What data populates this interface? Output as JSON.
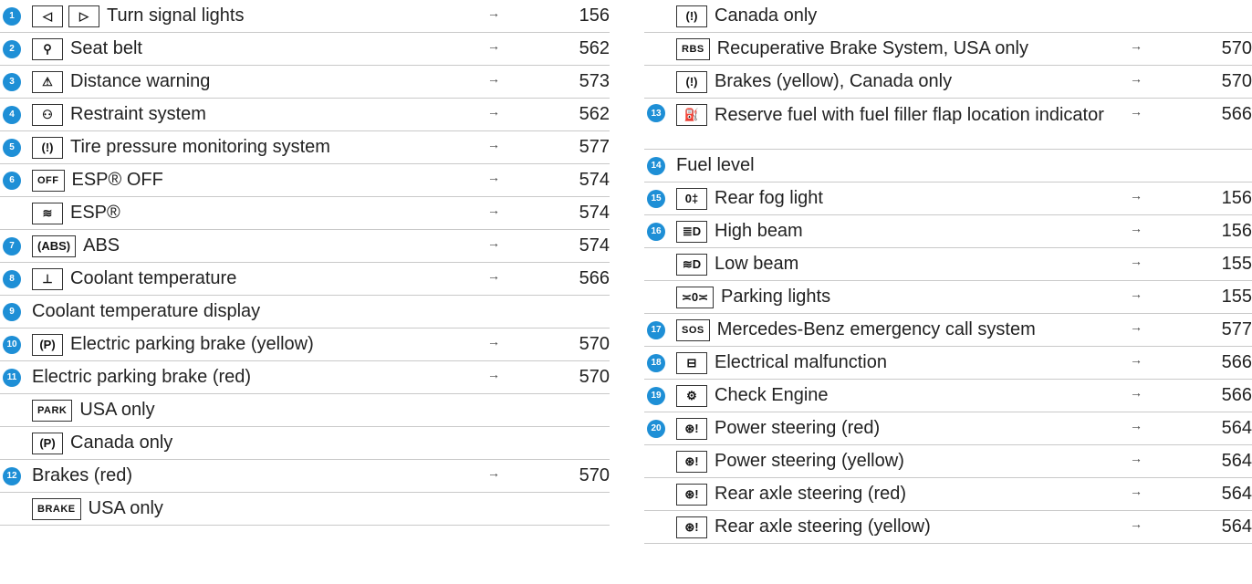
{
  "left": [
    {
      "num": "1",
      "icons": [
        "◁",
        "▷"
      ],
      "label": "Turn signal lights",
      "page": "156",
      "icon_names": [
        "turn-left-icon",
        "turn-right-icon"
      ]
    },
    {
      "num": "2",
      "icons": [
        "⚲"
      ],
      "label": "Seat belt",
      "page": "562",
      "icon_names": [
        "seat-belt-icon"
      ]
    },
    {
      "num": "3",
      "icons": [
        "⚠"
      ],
      "label": "Distance warning",
      "page": "573",
      "icon_names": [
        "distance-warning-icon"
      ]
    },
    {
      "num": "4",
      "icons": [
        "⚇"
      ],
      "label": "Restraint system",
      "page": "562",
      "icon_names": [
        "restraint-system-icon"
      ]
    },
    {
      "num": "5",
      "icons": [
        "(!)"
      ],
      "label": "Tire pressure monitoring system",
      "page": "577",
      "icon_names": [
        "tire-pressure-icon"
      ]
    },
    {
      "num": "6",
      "icons": [
        "OFF"
      ],
      "label": "ESP® OFF",
      "page": "574",
      "icon_names": [
        "esp-off-icon"
      ]
    },
    {
      "num": "",
      "icons": [
        "≋"
      ],
      "label": "ESP®",
      "page": "574",
      "icon_names": [
        "esp-icon"
      ]
    },
    {
      "num": "7",
      "icons": [
        "(ABS)"
      ],
      "label": "ABS",
      "page": "574",
      "icon_names": [
        "abs-icon"
      ]
    },
    {
      "num": "8",
      "icons": [
        "⊥"
      ],
      "label": "Coolant temperature",
      "page": "566",
      "icon_names": [
        "coolant-temperature-icon"
      ]
    },
    {
      "num": "9",
      "icons": [],
      "label": "Coolant temperature display",
      "page": "",
      "icon_names": []
    },
    {
      "num": "10",
      "icons": [
        "(P)"
      ],
      "label": "Electric parking brake (yellow)",
      "page": "570",
      "icon_names": [
        "parking-brake-icon"
      ]
    },
    {
      "num": "11",
      "icons": [],
      "label": "Electric parking brake (red)",
      "page": "570",
      "icon_names": []
    },
    {
      "num": "",
      "icons": [
        "PARK"
      ],
      "label": "USA only",
      "page": "",
      "icon_names": [
        "park-icon"
      ]
    },
    {
      "num": "",
      "icons": [
        "(P)"
      ],
      "label": "Canada only",
      "page": "",
      "icon_names": [
        "parking-brake-icon"
      ]
    },
    {
      "num": "12",
      "icons": [],
      "label": "Brakes (red)",
      "page": "570",
      "icon_names": []
    },
    {
      "num": "",
      "icons": [
        "BRAKE"
      ],
      "label": "USA only",
      "page": "",
      "icon_names": [
        "brake-text-icon"
      ]
    }
  ],
  "right": [
    {
      "num": "",
      "icons": [
        "(!)"
      ],
      "label": "Canada only",
      "page": "",
      "icon_names": [
        "brake-warning-icon"
      ],
      "tall": false
    },
    {
      "num": "",
      "icons": [
        "RBS"
      ],
      "label": "Recuperative Brake System, USA only",
      "page": "570",
      "icon_names": [
        "rbs-icon"
      ],
      "tall": false
    },
    {
      "num": "",
      "icons": [
        "(!)"
      ],
      "label": "Brakes (yellow), Canada only",
      "page": "570",
      "icon_names": [
        "brake-warning-icon"
      ],
      "tall": false
    },
    {
      "num": "13",
      "icons": [
        "⛽"
      ],
      "label": "Reserve fuel with fuel filler flap location indicator",
      "page": "566",
      "icon_names": [
        "reserve-fuel-icon"
      ],
      "tall": true
    },
    {
      "num": "14",
      "icons": [],
      "label": "Fuel level",
      "page": "",
      "icon_names": [],
      "tall": false
    },
    {
      "num": "15",
      "icons": [
        "0‡"
      ],
      "label": "Rear fog light",
      "page": "156",
      "icon_names": [
        "rear-fog-light-icon"
      ],
      "tall": false
    },
    {
      "num": "16",
      "icons": [
        "≣D"
      ],
      "label": "High beam",
      "page": "156",
      "icon_names": [
        "high-beam-icon"
      ],
      "tall": false
    },
    {
      "num": "",
      "icons": [
        "≋D"
      ],
      "label": "Low beam",
      "page": "155",
      "icon_names": [
        "low-beam-icon"
      ],
      "tall": false
    },
    {
      "num": "",
      "icons": [
        "≍0≍"
      ],
      "label": "Parking lights",
      "page": "155",
      "icon_names": [
        "parking-lights-icon"
      ],
      "tall": false
    },
    {
      "num": "17",
      "icons": [
        "SOS"
      ],
      "label": "Mercedes-Benz emergency call system",
      "page": "577",
      "icon_names": [
        "sos-not-ready-icon"
      ],
      "tall": false
    },
    {
      "num": "18",
      "icons": [
        "⊟"
      ],
      "label": "Electrical malfunction",
      "page": "566",
      "icon_names": [
        "battery-icon"
      ],
      "tall": false
    },
    {
      "num": "19",
      "icons": [
        "⚙"
      ],
      "label": "Check Engine",
      "page": "566",
      "icon_names": [
        "check-engine-icon"
      ],
      "tall": false
    },
    {
      "num": "20",
      "icons": [
        "⊛!"
      ],
      "label": "Power steering (red)",
      "page": "564",
      "icon_names": [
        "steering-wheel-icon"
      ],
      "tall": false
    },
    {
      "num": "",
      "icons": [
        "⊛!"
      ],
      "label": "Power steering (yellow)",
      "page": "564",
      "icon_names": [
        "steering-wheel-icon"
      ],
      "tall": false
    },
    {
      "num": "",
      "icons": [
        "⊛!"
      ],
      "label": "Rear axle steering (red)",
      "page": "564",
      "icon_names": [
        "steering-wheel-icon"
      ],
      "tall": false
    },
    {
      "num": "",
      "icons": [
        "⊛!"
      ],
      "label": "Rear axle steering (yellow)",
      "page": "564",
      "icon_names": [
        "steering-wheel-icon"
      ],
      "tall": false
    }
  ],
  "arrow_glyph": "→",
  "colors": {
    "badge": "#1e8fd6",
    "rule": "#c9c9c9"
  }
}
